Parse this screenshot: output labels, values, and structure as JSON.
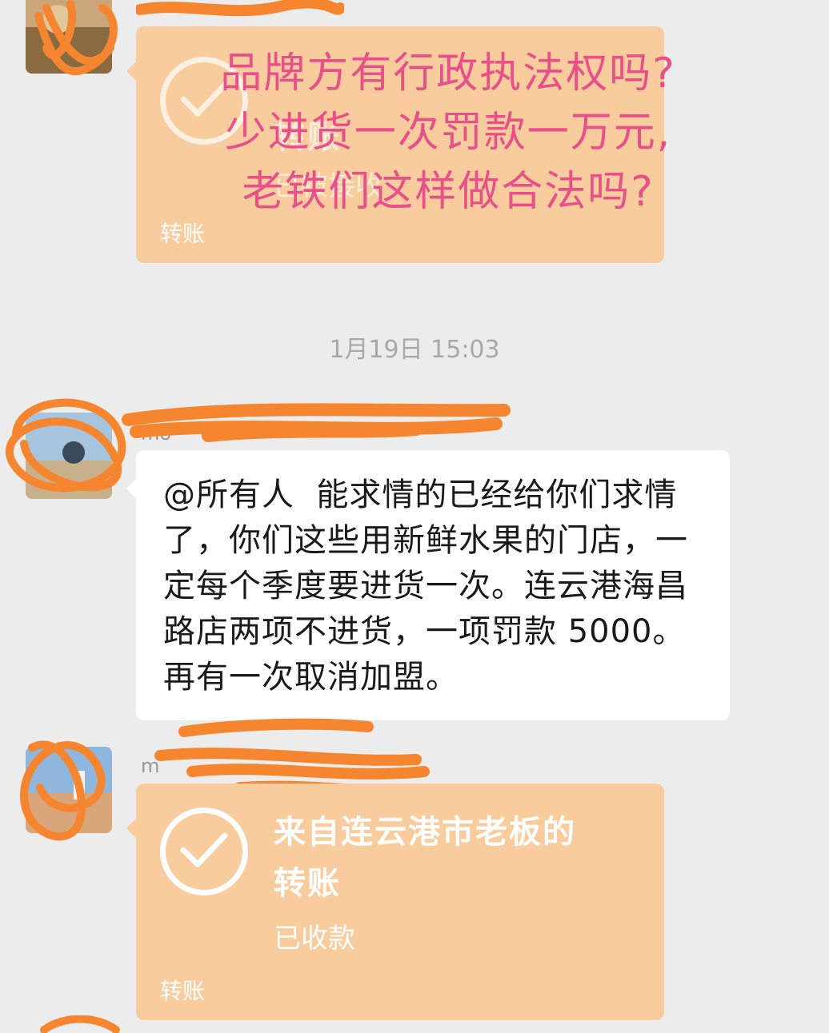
{
  "overlay": {
    "caption": "品牌方有行政执法权吗?\n少进货一次罚款一万元,\n老铁们这样做合法吗?"
  },
  "messages": [
    {
      "type": "transfer",
      "title_line1": "",
      "title_line2": "转账",
      "status": "已被接收",
      "footer": "转账"
    },
    {
      "type": "timestamp",
      "text": "1月19日 15:03"
    },
    {
      "type": "text",
      "nickname": "mo",
      "content": "@所有人  能求情的已经给你们求情了，你们这些用新鲜水果的门店，一定每个季度要进货一次。连云港海昌路店两项不进货，一项罚款 5000。再有一次取消加盟。"
    },
    {
      "type": "transfer",
      "nickname": "m",
      "title_line1": "来自连云港市老板的",
      "title_line2": "转账",
      "status": "已收款",
      "footer": "转账"
    }
  ],
  "colors": {
    "background": "#ececec",
    "transfer_bubble": "#f9cc9d",
    "text_bubble": "#ffffff",
    "overlay_text": "#e8508a",
    "scribble": "#f5852e"
  },
  "icons": [
    "check-icon",
    "avatar"
  ]
}
